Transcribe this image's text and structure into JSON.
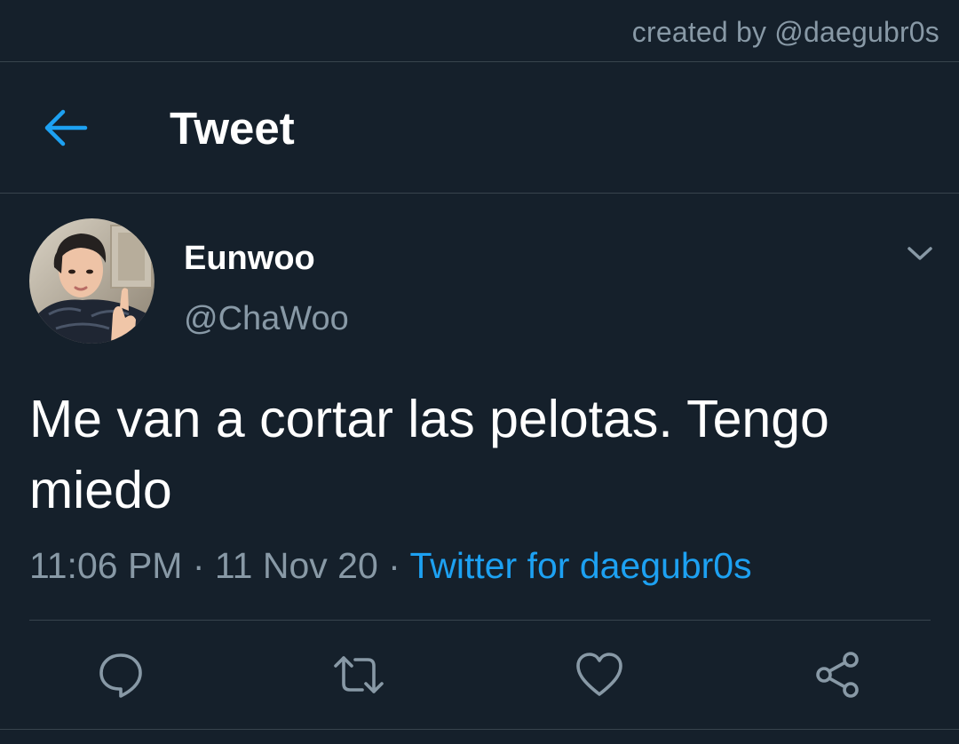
{
  "watermark": "created by @daegubr0s",
  "header": {
    "back_icon": "arrow-left-icon",
    "title": "Tweet"
  },
  "tweet": {
    "author": {
      "display_name": "Eunwoo",
      "handle": "@ChaWoo",
      "avatar": "profile-photo"
    },
    "more_icon": "chevron-down-icon",
    "text": "Me van a cortar las pelotas. Tengo miedo",
    "meta": {
      "time": "11:06 PM",
      "separator": " · ",
      "date": "11 Nov 20",
      "source": "Twitter for daegubr0s"
    },
    "actions": [
      {
        "icon": "reply-icon"
      },
      {
        "icon": "retweet-icon"
      },
      {
        "icon": "like-icon"
      },
      {
        "icon": "share-icon"
      }
    ]
  },
  "colors": {
    "background": "#15202b",
    "accent": "#1da1f2",
    "secondary_text": "#8899a6",
    "divider": "#38444d"
  }
}
